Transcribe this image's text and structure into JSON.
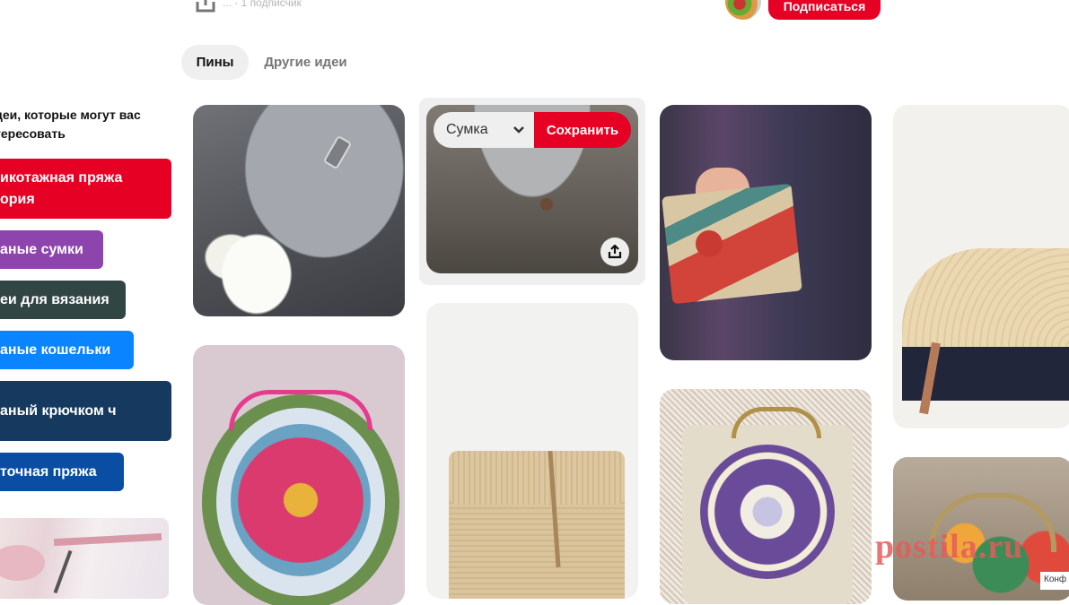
{
  "header": {
    "followers_text": "... · 1 подписчик",
    "follow_button": "Подписаться"
  },
  "tabs": [
    {
      "label": "Пины",
      "active": true
    },
    {
      "label": "Другие идеи",
      "active": false
    }
  ],
  "sidebar": {
    "heading": "деи, которые могут вас тересовать",
    "chips": [
      {
        "label": "икотажная пряжа ория",
        "color": "#e60023"
      },
      {
        "label": "аные сумки",
        "color": "#8e44ad"
      },
      {
        "label": "еи для вязания",
        "color": "#324545"
      },
      {
        "label": "аные кошельки",
        "color": "#0a84ff"
      },
      {
        "label": "аный крючком ч",
        "color": "#163a5f"
      },
      {
        "label": "точная пряжа",
        "color": "#0a4ea4"
      }
    ]
  },
  "pin_overlay": {
    "board_select": "Сумка",
    "save_button": "Сохранить"
  },
  "pins": [
    {
      "name": "grey-crochet-clutch"
    },
    {
      "name": "grey-lace-flap-bag"
    },
    {
      "name": "raffia-clutch-with-pompom"
    },
    {
      "name": "straw-half-circle-clutch"
    },
    {
      "name": "flower-crochet-coin-purse"
    },
    {
      "name": "raffia-envelope-bag"
    },
    {
      "name": "granny-square-coin-purse"
    },
    {
      "name": "colorful-crochet-purse"
    }
  ],
  "watermark": "postila.ru",
  "corner_label": "Конф"
}
